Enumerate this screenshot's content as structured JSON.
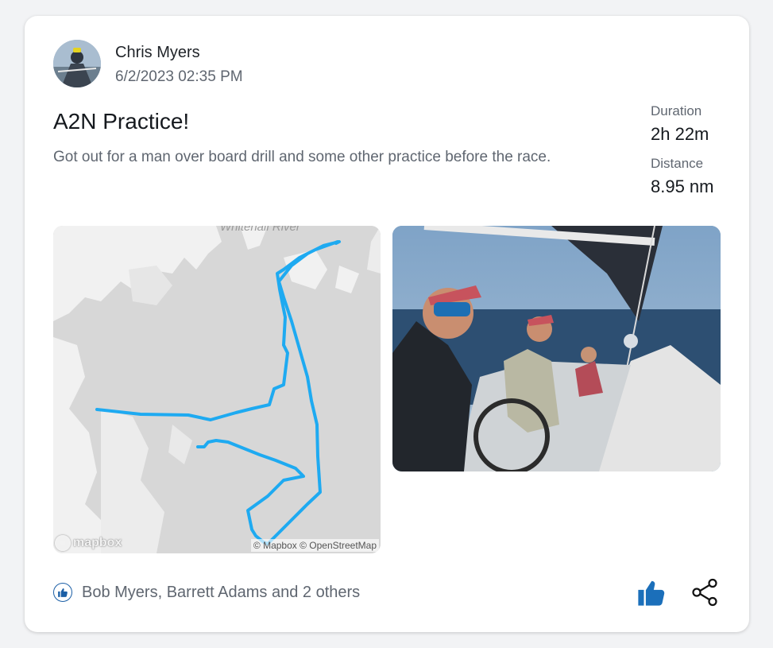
{
  "post": {
    "author": "Chris Myers",
    "timestamp": "6/2/2023 02:35 PM",
    "title": "A2N Practice!",
    "description": "Got out for a man over board drill and some other practice before the race."
  },
  "stats": {
    "duration_label": "Duration",
    "duration_value": "2h 22m",
    "distance_label": "Distance",
    "distance_value": "8.95 nm"
  },
  "map": {
    "river_label": "Whitehall River",
    "attribution": "© Mapbox © OpenStreetMap",
    "logo": "mapbox",
    "track_color": "#1eaaf1"
  },
  "likes": {
    "text": "Bob Myers, Barrett Adams and 2 others"
  },
  "colors": {
    "like_accent": "#1b6fba"
  },
  "icons": {
    "like_badge": "thumbs-up-icon",
    "like_button": "thumbs-up-icon",
    "share": "share-icon"
  }
}
